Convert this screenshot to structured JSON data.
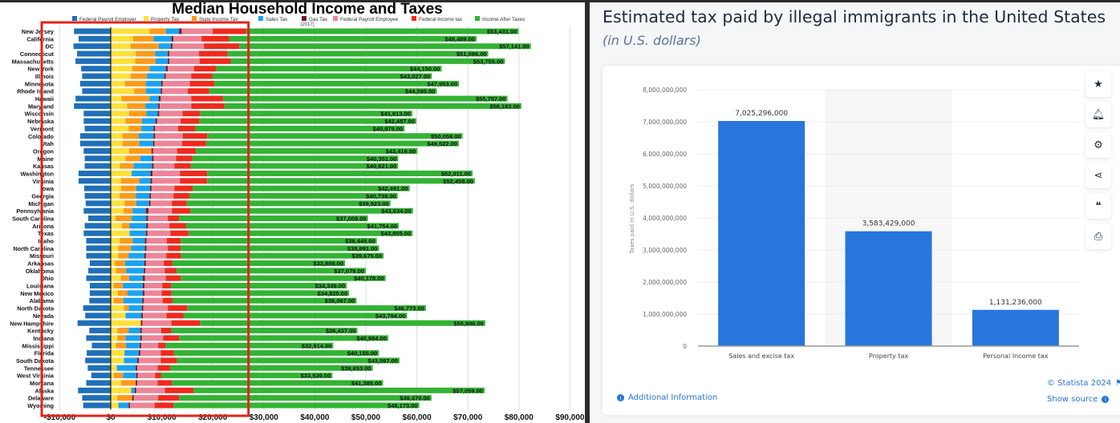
{
  "chart_data": [
    {
      "type": "bar",
      "orientation": "horizontal-stacked",
      "title": "Median Household Income and Taxes",
      "subtitle": "(2017)",
      "xlim": [
        -10000,
        90000
      ],
      "xticks": [
        "-$10,000",
        "$0",
        "$10,000",
        "$20,000",
        "$30,000",
        "$40,000",
        "$50,000",
        "$60,000",
        "$70,000",
        "$80,000",
        "$90,000"
      ],
      "grid": "vertical",
      "legend_position": "top",
      "series": [
        {
          "name": "Federal Payroll Employer",
          "color": "#1f6fb8"
        },
        {
          "name": "Property Tax",
          "color": "#ffe03a"
        },
        {
          "name": "State Income Tax",
          "color": "#ff9a1a"
        },
        {
          "name": "Sales Tax",
          "color": "#1aa3f0"
        },
        {
          "name": "Gas Tax",
          "color": "#6b1a2a"
        },
        {
          "name": "Federal Payroll Employee",
          "color": "#ec8597"
        },
        {
          "name": "Federal Income tax",
          "color": "#ee2a1e"
        },
        {
          "name": "Income After Taxes",
          "color": "#33b334"
        }
      ],
      "categories": [
        "New Jersey",
        "California",
        "DC",
        "Connecticut",
        "Massachusetts",
        "New York",
        "Illinois",
        "Minnesota",
        "Rhode Island",
        "Hawaii",
        "Maryland",
        "Wisconsin",
        "Nebraska",
        "Vermont",
        "Colorado",
        "Utah",
        "Oregon",
        "Maine",
        "Kansas",
        "Washington",
        "Virginia",
        "Iowa",
        "Georgia",
        "Michigan",
        "Pennsylvania",
        "South Carolina",
        "Arizona",
        "Texas",
        "Idaho",
        "North Carolina",
        "Missouri",
        "Arkansas",
        "Oklahoma",
        "Ohio",
        "Louisiana",
        "New Mexico",
        "Alabama",
        "North Dakota",
        "Nevada",
        "New Hampshire",
        "Kentucky",
        "Indiana",
        "Mississippi",
        "Florida",
        "South Dakota",
        "Tennessee",
        "West Virginia",
        "Montana",
        "Alaska",
        "Delaware",
        "Wyoming"
      ],
      "values_by_category": [
        [
          -7200,
          7600,
          3200,
          2600,
          500,
          6100,
          6500,
          53431
        ],
        [
          -6300,
          4400,
          4000,
          3500,
          400,
          5500,
          5400,
          48489
        ],
        [
          -7300,
          3900,
          5500,
          2400,
          300,
          6200,
          6900,
          57141
        ],
        [
          -6600,
          4900,
          3800,
          2500,
          300,
          5800,
          5600,
          51086
        ],
        [
          -6900,
          4800,
          4000,
          2400,
          300,
          5900,
          6100,
          53755
        ],
        [
          -5800,
          4200,
          3400,
          3200,
          400,
          5100,
          4400,
          44150
        ],
        [
          -5600,
          3900,
          3200,
          3400,
          300,
          5000,
          4100,
          43027
        ],
        [
          -6000,
          2800,
          4100,
          3000,
          300,
          5300,
          4800,
          47953
        ],
        [
          -5600,
          4600,
          2300,
          2900,
          300,
          5000,
          4200,
          44595
        ],
        [
          -6900,
          2100,
          5500,
          1800,
          400,
          6000,
          6200,
          55757
        ],
        [
          -7200,
          3200,
          3600,
          2500,
          300,
          6200,
          6500,
          58183
        ],
        [
          -5300,
          3600,
          3400,
          2200,
          300,
          4600,
          3400,
          41613
        ],
        [
          -5300,
          2900,
          3200,
          2700,
          300,
          4600,
          3700,
          42487
        ],
        [
          -5100,
          3500,
          2500,
          2400,
          300,
          4500,
          3400,
          40975
        ],
        [
          -6000,
          2300,
          3200,
          2900,
          300,
          5400,
          4800,
          50058
        ],
        [
          -6000,
          2300,
          3300,
          2700,
          300,
          5400,
          4700,
          49522
        ],
        [
          -5300,
          3600,
          4400,
          0,
          300,
          4700,
          3700,
          43416
        ],
        [
          -5100,
          2900,
          2900,
          2300,
          300,
          4400,
          3200,
          40351
        ],
        [
          -5100,
          1800,
          2700,
          3600,
          300,
          4100,
          3200,
          40621
        ],
        [
          -6300,
          4100,
          0,
          3700,
          400,
          5400,
          5300,
          52011
        ],
        [
          -6300,
          2000,
          3600,
          2200,
          300,
          5500,
          5300,
          52458
        ],
        [
          -5200,
          2000,
          3000,
          2700,
          300,
          4500,
          3600,
          42491
        ],
        [
          -5100,
          1700,
          3200,
          2700,
          300,
          4400,
          3200,
          40738
        ],
        [
          -4900,
          2700,
          2300,
          2500,
          300,
          4200,
          2900,
          39923
        ],
        [
          -5300,
          2500,
          1800,
          2600,
          500,
          4600,
          3600,
          43634
        ],
        [
          -4400,
          900,
          3200,
          2900,
          300,
          3900,
          2200,
          37009
        ],
        [
          -5100,
          2200,
          1500,
          3300,
          300,
          4200,
          3200,
          41754
        ],
        [
          -5300,
          3700,
          0,
          3200,
          300,
          4500,
          3600,
          43855
        ],
        [
          -4800,
          1800,
          2500,
          2400,
          300,
          4000,
          2700,
          38445
        ],
        [
          -4800,
          1500,
          2500,
          2700,
          300,
          4200,
          2500,
          38891
        ],
        [
          -4800,
          1500,
          2000,
          3100,
          300,
          4000,
          2900,
          39675
        ],
        [
          -4100,
          800,
          2000,
          3800,
          300,
          3500,
          1700,
          33809
        ],
        [
          -4400,
          1000,
          2000,
          3500,
          300,
          3800,
          2300,
          37079
        ],
        [
          -4800,
          2000,
          1600,
          2700,
          400,
          4100,
          2900,
          40178
        ],
        [
          -4100,
          600,
          1800,
          3900,
          300,
          3500,
          1800,
          34349
        ],
        [
          -4100,
          1400,
          1900,
          3000,
          300,
          3400,
          1900,
          34825
        ],
        [
          -4200,
          600,
          1900,
          3700,
          300,
          3700,
          1900,
          36067
        ],
        [
          -5400,
          2600,
          900,
          2600,
          300,
          4800,
          3800,
          46773
        ],
        [
          -5000,
          2900,
          0,
          3100,
          300,
          4600,
          3400,
          43794
        ],
        [
          -6500,
          5900,
          0,
          0,
          300,
          5700,
          5600,
          55906
        ],
        [
          -4200,
          1300,
          2200,
          2300,
          300,
          3800,
          2000,
          36437
        ],
        [
          -4800,
          1300,
          1600,
          2900,
          300,
          4200,
          3100,
          40984
        ],
        [
          -3700,
          1000,
          2000,
          2700,
          300,
          3300,
          1400,
          32914
        ],
        [
          -4700,
          2700,
          0,
          2800,
          300,
          4000,
          2600,
          40155
        ],
        [
          -5000,
          2600,
          0,
          2600,
          300,
          4300,
          3200,
          43597
        ],
        [
          -4500,
          1200,
          0,
          3700,
          300,
          4000,
          2500,
          39653
        ],
        [
          -3800,
          600,
          1800,
          2600,
          300,
          3400,
          1200,
          33539
        ],
        [
          -4800,
          2000,
          2900,
          0,
          300,
          4000,
          2800,
          41385
        ],
        [
          -6400,
          4000,
          0,
          700,
          300,
          5600,
          5600,
          57059
        ],
        [
          -5600,
          1300,
          2900,
          0,
          300,
          4800,
          4100,
          49470
        ],
        [
          -5400,
          1500,
          0,
          2000,
          300,
          4800,
          3700,
          48173
        ]
      ],
      "data_labels": [
        "$53,431.00",
        "$48,489.00",
        "$57,141.00",
        "$51,086.00",
        "$53,755.00",
        "$44,150.00",
        "$43,027.00",
        "$47,953.00",
        "$44,595.00",
        "$55,757.00",
        "$58,183.00",
        "$41,613.00",
        "$42,487.00",
        "$40,975.00",
        "$50,058.00",
        "$49,522.00",
        "$43,416.00",
        "$40,351.00",
        "$40,621.00",
        "$52,011.00",
        "$52,458.00",
        "$42,491.00",
        "$40,738.00",
        "$39,923.00",
        "$43,634.00",
        "$37,009.00",
        "$41,754.00",
        "$43,855.00",
        "$38,445.00",
        "$38,891.00",
        "$39,675.00",
        "$33,809.00",
        "$37,079.00",
        "$40,178.00",
        "$34,349.00",
        "$34,825.00",
        "$36,067.00",
        "$46,773.00",
        "$43,794.00",
        "$55,906.00",
        "$36,437.00",
        "$40,984.00",
        "$32,914.00",
        "$40,155.00",
        "$43,597.00",
        "$39,653.00",
        "$33,539.00",
        "$41,385.00",
        "$57,059.00",
        "$49,470.00",
        "$48,173.00"
      ],
      "annotation": {
        "type": "highlight-box",
        "range": [
          -10000,
          27000
        ],
        "color": "#e0251b"
      }
    },
    {
      "type": "bar",
      "title": "Estimated tax paid by illegal immigrants in the United States",
      "subtitle": "(in U.S. dollars)",
      "ylabel": "Taxes paid in U.S. dollars",
      "ylim": [
        0,
        8000000000
      ],
      "yticks": [
        "0",
        "1,000,000,000",
        "2,000,000,000",
        "3,000,000,000",
        "4,000,000,000",
        "5,000,000,000",
        "6,000,000,000",
        "7,000,000,000",
        "8,000,000,000"
      ],
      "categories": [
        "Sales and excise tax",
        "Property tax",
        "Personal Income tax"
      ],
      "values": [
        7025296000,
        3583429000,
        1131236000
      ],
      "data_labels": [
        "7,025,296,000",
        "3,583,429,000",
        "1,131,236,000"
      ],
      "color": "#2876dd",
      "grid": "horizontal-dotted"
    }
  ],
  "statista": {
    "tools": [
      "star-icon",
      "bell-icon",
      "gear-icon",
      "share-icon",
      "quote-icon",
      "print-icon"
    ],
    "copyright": "© Statista 2024",
    "additional_info": "Additional Information",
    "show_source": "Show source"
  }
}
